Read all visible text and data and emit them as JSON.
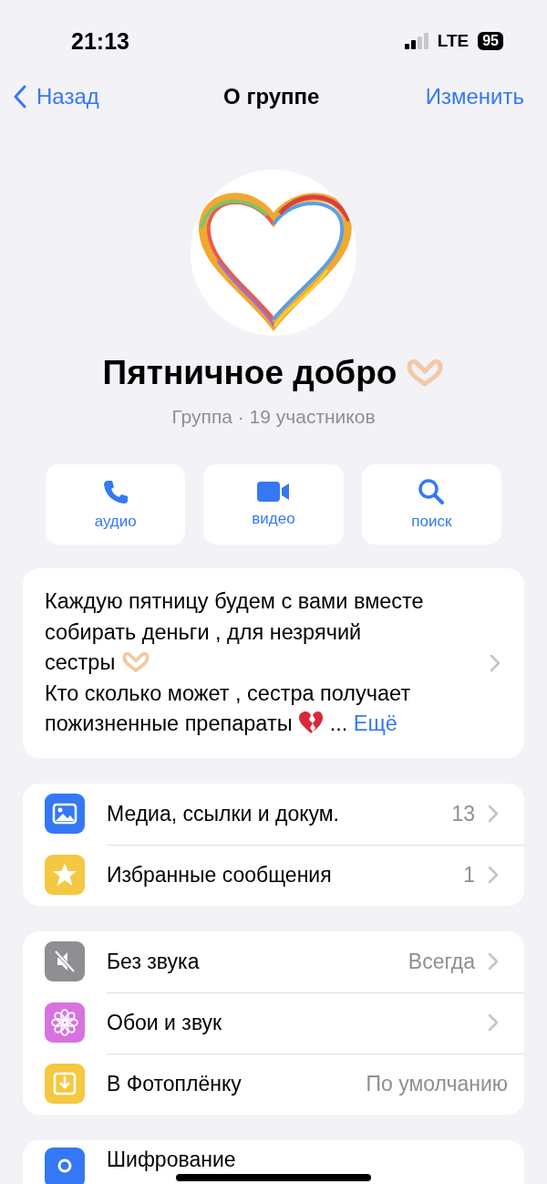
{
  "status_bar": {
    "time": "21:13",
    "network": "LTE",
    "battery": "95"
  },
  "nav": {
    "back": "Назад",
    "title": "О группе",
    "edit": "Изменить"
  },
  "profile": {
    "name": "Пятничное добро",
    "subtitle": "Группа · 19 участников"
  },
  "actions": [
    {
      "kind": "audio",
      "label": "аудио"
    },
    {
      "kind": "video",
      "label": "видео"
    },
    {
      "kind": "search",
      "label": "поиск"
    }
  ],
  "description": {
    "lines": [
      {
        "text": "Каждую пятницу будем с вами вместе"
      },
      {
        "text": "собирать деньги , для незрячий"
      },
      {
        "text": "сестры"
      },
      {
        "text": "Кто сколько может , сестра получает"
      },
      {
        "text": "пожизненные препараты"
      }
    ],
    "ellipsis": "...",
    "more": "Ещё"
  },
  "groups": [
    {
      "items": [
        {
          "kind": "media",
          "label": "Медиа, ссылки и докум.",
          "value": "13",
          "chevron": true
        },
        {
          "kind": "starred",
          "label": "Избранные сообщения",
          "value": "1",
          "chevron": true
        }
      ]
    },
    {
      "items": [
        {
          "kind": "mute",
          "label": "Без звука",
          "value": "Всегда",
          "chevron": true
        },
        {
          "kind": "wallpaper",
          "label": "Обои и звук",
          "chevron": true
        },
        {
          "kind": "save",
          "label": "В Фотоплёнку",
          "value": "По умолчанию",
          "chevron": false
        }
      ]
    },
    {
      "items": [
        {
          "kind": "encryption",
          "label": "Шифрование"
        }
      ]
    }
  ]
}
